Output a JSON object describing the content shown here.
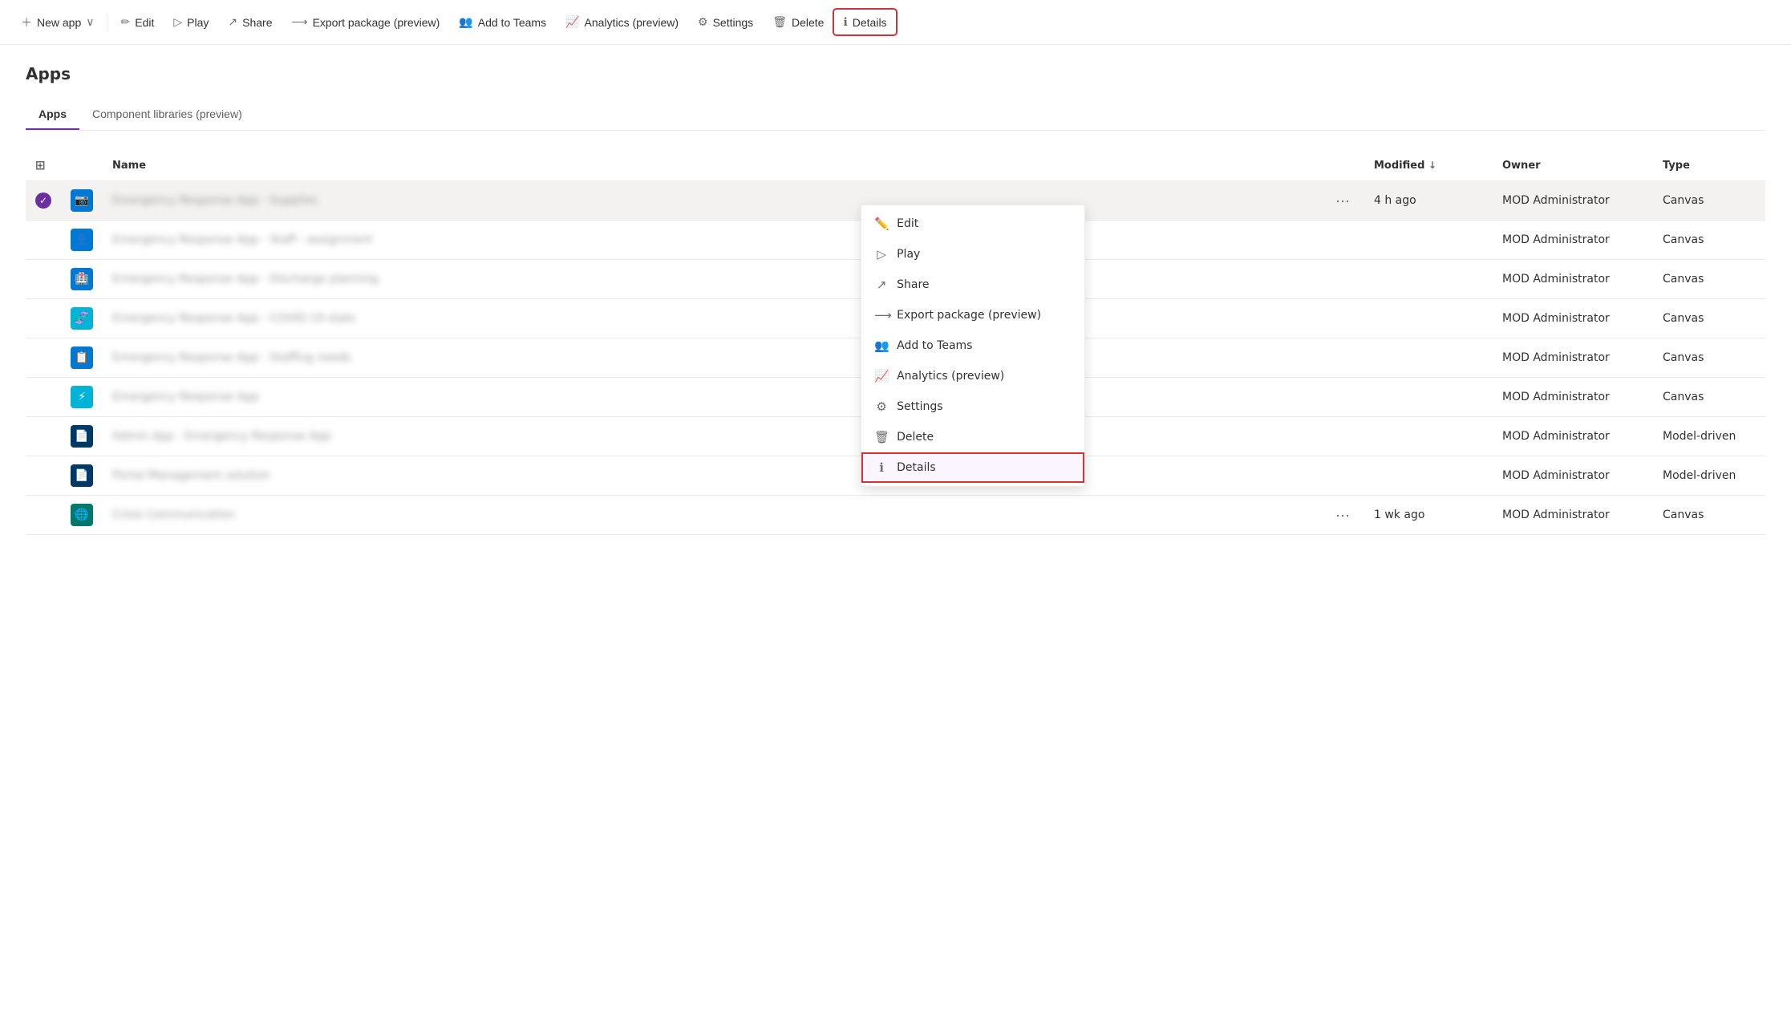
{
  "toolbar": {
    "new_app_label": "New app",
    "edit_label": "Edit",
    "play_label": "Play",
    "share_label": "Share",
    "export_label": "Export package (preview)",
    "add_to_teams_label": "Add to Teams",
    "analytics_label": "Analytics (preview)",
    "settings_label": "Settings",
    "delete_label": "Delete",
    "details_label": "Details"
  },
  "page": {
    "title": "Apps"
  },
  "tabs": [
    {
      "label": "Apps",
      "active": true
    },
    {
      "label": "Component libraries (preview)",
      "active": false
    }
  ],
  "table": {
    "columns": [
      {
        "key": "check",
        "label": ""
      },
      {
        "key": "icon",
        "label": ""
      },
      {
        "key": "name",
        "label": "Name"
      },
      {
        "key": "dots",
        "label": ""
      },
      {
        "key": "modified",
        "label": "Modified"
      },
      {
        "key": "owner",
        "label": "Owner"
      },
      {
        "key": "type",
        "label": "Type"
      }
    ],
    "rows": [
      {
        "selected": true,
        "iconClass": "icon-blue",
        "iconSymbol": "📷",
        "name": "Emergency Response App - Supplies",
        "modified": "4 h ago",
        "owner": "MOD Administrator",
        "type": "Canvas",
        "showDots": true
      },
      {
        "selected": false,
        "iconClass": "icon-blue",
        "iconSymbol": "👤",
        "name": "Emergency Response App - Staff - assignment",
        "modified": "",
        "owner": "MOD Administrator",
        "type": "Canvas",
        "showDots": false
      },
      {
        "selected": false,
        "iconClass": "icon-blue",
        "iconSymbol": "🏥",
        "name": "Emergency Response App - Discharge planning",
        "modified": "",
        "owner": "MOD Administrator",
        "type": "Canvas",
        "showDots": false
      },
      {
        "selected": false,
        "iconClass": "icon-cyan",
        "iconSymbol": "🧬",
        "name": "Emergency Response App - COVID-19 stats",
        "modified": "",
        "owner": "MOD Administrator",
        "type": "Canvas",
        "showDots": false
      },
      {
        "selected": false,
        "iconClass": "icon-blue",
        "iconSymbol": "📋",
        "name": "Emergency Response App - Staffing needs",
        "modified": "",
        "owner": "MOD Administrator",
        "type": "Canvas",
        "showDots": false
      },
      {
        "selected": false,
        "iconClass": "icon-cyan",
        "iconSymbol": "⚡",
        "name": "Emergency Response App",
        "modified": "",
        "owner": "MOD Administrator",
        "type": "Canvas",
        "showDots": false
      },
      {
        "selected": false,
        "iconClass": "icon-dark",
        "iconSymbol": "📄",
        "name": "Admin App - Emergency Response App",
        "modified": "",
        "owner": "MOD Administrator",
        "type": "Model-driven",
        "showDots": false
      },
      {
        "selected": false,
        "iconClass": "icon-dark",
        "iconSymbol": "📄",
        "name": "Portal Management solution",
        "modified": "",
        "owner": "MOD Administrator",
        "type": "Model-driven",
        "showDots": false
      },
      {
        "selected": false,
        "iconClass": "icon-teal",
        "iconSymbol": "🌐",
        "name": "Crisis Communication",
        "modified": "1 wk ago",
        "owner": "MOD Administrator",
        "type": "Canvas",
        "showDots": true
      }
    ]
  },
  "context_menu": {
    "items": [
      {
        "label": "Edit",
        "icon": "✏️",
        "highlighted": false
      },
      {
        "label": "Play",
        "icon": "▷",
        "highlighted": false
      },
      {
        "label": "Share",
        "icon": "↗",
        "highlighted": false
      },
      {
        "label": "Export package (preview)",
        "icon": "⟶",
        "highlighted": false
      },
      {
        "label": "Add to Teams",
        "icon": "👥",
        "highlighted": false
      },
      {
        "label": "Analytics (preview)",
        "icon": "📈",
        "highlighted": false
      },
      {
        "label": "Settings",
        "icon": "⚙",
        "highlighted": false
      },
      {
        "label": "Delete",
        "icon": "🗑",
        "highlighted": false
      },
      {
        "label": "Details",
        "icon": "ℹ",
        "highlighted": true
      }
    ]
  }
}
